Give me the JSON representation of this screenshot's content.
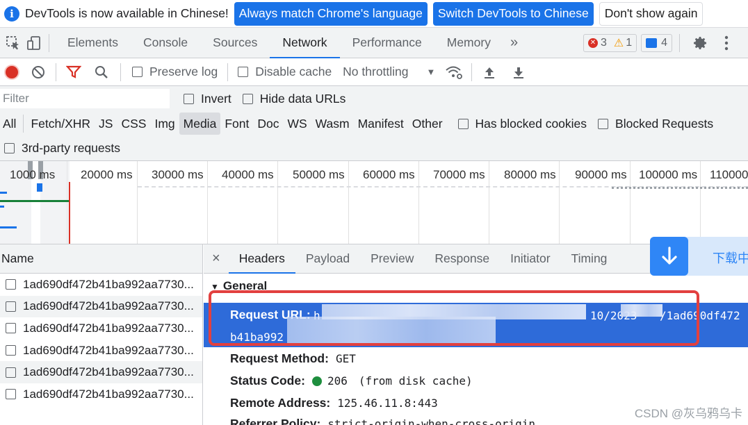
{
  "infobar": {
    "message": "DevTools is now available in Chinese!",
    "btn_match": "Always match Chrome's language",
    "btn_switch": "Switch DevTools to Chinese",
    "btn_dismiss": "Don't show again"
  },
  "tabs": [
    "Elements",
    "Console",
    "Sources",
    "Network",
    "Performance",
    "Memory"
  ],
  "active_tab": "Network",
  "more_tabs": "»",
  "counts": {
    "errors": "3",
    "warnings": "1",
    "messages": "4"
  },
  "network_toolbar": {
    "preserve_log": "Preserve log",
    "disable_cache": "Disable cache",
    "throttling": "No throttling"
  },
  "filter": {
    "placeholder": "Filter",
    "invert": "Invert",
    "hide_data_urls": "Hide data URLs",
    "types": [
      "All",
      "Fetch/XHR",
      "JS",
      "CSS",
      "Img",
      "Media",
      "Font",
      "Doc",
      "WS",
      "Wasm",
      "Manifest",
      "Other"
    ],
    "active_type": "Media",
    "has_blocked_cookies": "Has blocked cookies",
    "blocked_requests": "Blocked Requests",
    "third_party": "3rd-party requests"
  },
  "timeline": {
    "ticks": [
      "1000 ms",
      "20000 ms",
      "30000 ms",
      "40000 ms",
      "50000 ms",
      "60000 ms",
      "70000 ms",
      "80000 ms",
      "90000 ms",
      "100000 ms",
      "110000"
    ]
  },
  "request_list": {
    "header": "Name",
    "rows": [
      "1ad690df472b41ba992aa7730...",
      "1ad690df472b41ba992aa7730...",
      "1ad690df472b41ba992aa7730...",
      "1ad690df472b41ba992aa7730...",
      "1ad690df472b41ba992aa7730...",
      "1ad690df472b41ba992aa7730..."
    ]
  },
  "detail": {
    "close": "×",
    "tabs": [
      "Headers",
      "Payload",
      "Preview",
      "Response",
      "Initiator",
      "Timing"
    ],
    "active_tab": "Headers",
    "section": "General",
    "request_url_label": "Request URL:",
    "request_url_start": "h",
    "request_url_tail": "10/2023",
    "request_url_tail2": "/1ad690df472",
    "request_url_line2": "b41ba992",
    "request_method_label": "Request Method:",
    "request_method": "GET",
    "status_code_label": "Status Code:",
    "status_code": "206",
    "status_note": "(from disk cache)",
    "remote_address_label": "Remote Address:",
    "remote_address": "125.46.11.8:443",
    "referrer_policy_label": "Referrer Policy:",
    "referrer_policy": "strict-origin-when-cross-origin"
  },
  "download_widget": {
    "text": "下载中"
  },
  "watermark": "CSDN @灰乌鸦乌卡",
  "colors": {
    "accent": "#1a73e8",
    "highlight": "#2e6bd9",
    "annotation": "#e2403f"
  }
}
